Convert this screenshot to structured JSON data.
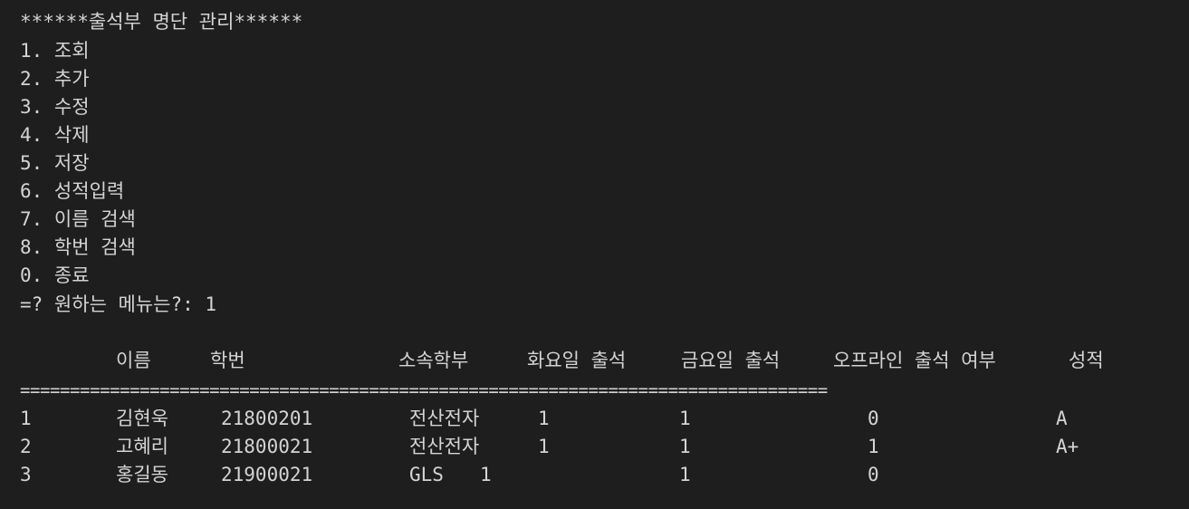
{
  "menu": {
    "title": "******출석부 명단 관리******",
    "items": [
      "1. 조회",
      "2. 추가",
      "3. 수정",
      "4. 삭제",
      "5. 저장",
      "6. 성적입력",
      "7. 이름 검색",
      "8. 학번 검색",
      "0. 종료"
    ],
    "prompt": "=? 원하는 메뉴는?: 1"
  },
  "table": {
    "headers": {
      "name": "이름",
      "student_id": "학번",
      "department": "소속학부",
      "tuesday": "화요일 출석",
      "friday": "금요일 출석",
      "offline": "오프라인 출석 여부",
      "grade": "성적"
    },
    "separator": "=================================================================================",
    "rows": [
      {
        "no": "1",
        "name": "김현욱",
        "student_id": "21800201",
        "department": "전산전자",
        "tuesday": "1",
        "friday": "1",
        "offline": "0",
        "grade": "A"
      },
      {
        "no": "2",
        "name": "고혜리",
        "student_id": "21800021",
        "department": "전산전자",
        "tuesday": "1",
        "friday": "1",
        "offline": "1",
        "grade": "A+"
      },
      {
        "no": "3",
        "name": "홍길동",
        "student_id": "21900021",
        "department": "GLS",
        "tuesday": "1",
        "friday": "1",
        "offline": "0",
        "grade": ""
      }
    ]
  }
}
